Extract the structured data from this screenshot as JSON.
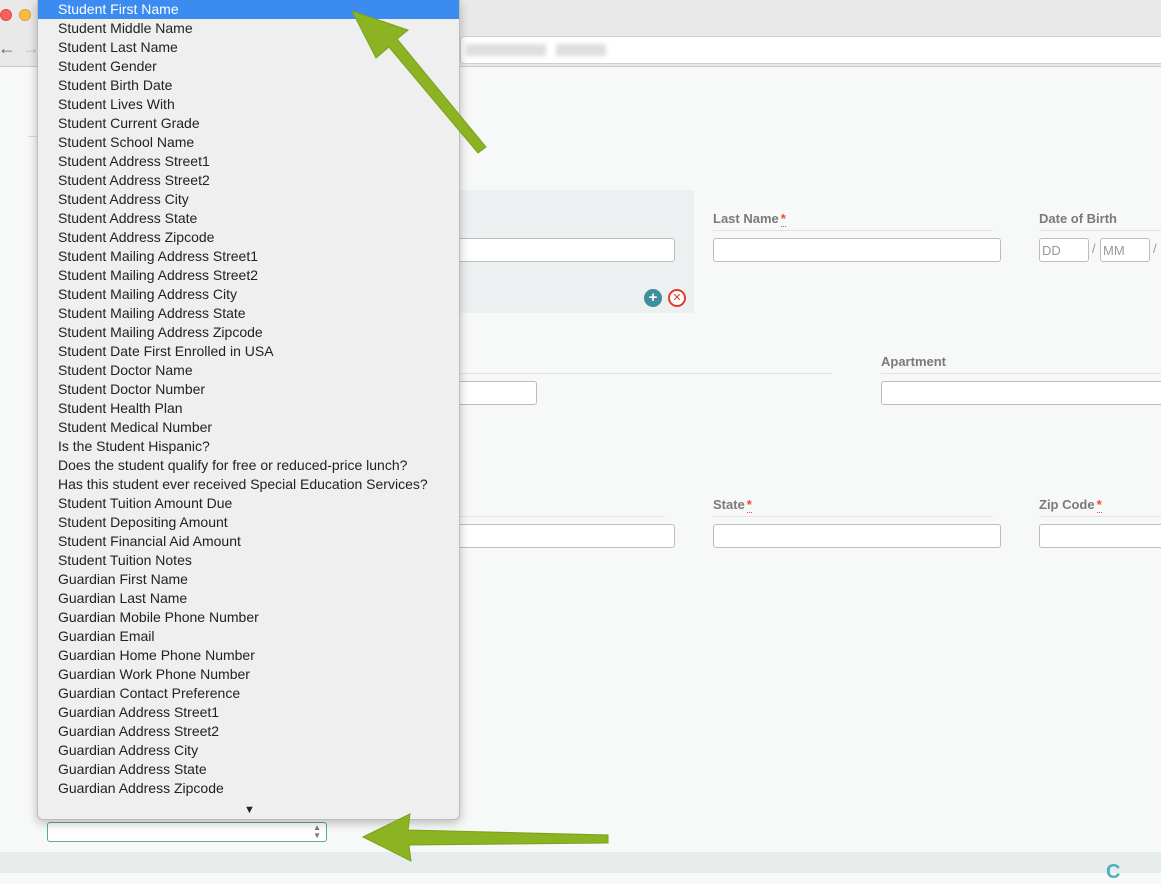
{
  "browser": {
    "nav_back_icon": "←",
    "nav_forward_icon": "→"
  },
  "form": {
    "last_name_label": "Last Name",
    "dob_label": "Date of Birth",
    "dob_dd_placeholder": "DD",
    "dob_mm_placeholder": "MM",
    "apartment_label": "Apartment",
    "state_label": "State",
    "zip_label": "Zip Code",
    "required_mark": "*",
    "slash": "/"
  },
  "dropdown": {
    "selected_index": 0,
    "options": [
      "Student First Name",
      "Student Middle Name",
      "Student Last Name",
      "Student Gender",
      "Student Birth Date",
      "Student Lives With",
      "Student Current Grade",
      "Student School Name",
      "Student Address Street1",
      "Student Address Street2",
      "Student Address City",
      "Student Address State",
      "Student Address Zipcode",
      "Student Mailing Address Street1",
      "Student Mailing Address Street2",
      "Student Mailing Address City",
      "Student Mailing Address State",
      "Student Mailing Address Zipcode",
      "Student Date First Enrolled in USA",
      "Student Doctor Name",
      "Student Doctor Number",
      "Student Health Plan",
      "Student Medical Number",
      "Is the Student Hispanic?",
      "Does the student qualify for free or reduced-price lunch?",
      "Has this student ever received Special Education Services?",
      "Student Tuition Amount Due",
      "Student Depositing Amount",
      "Student Financial Aid Amount",
      "Student Tuition Notes",
      "Guardian First Name",
      "Guardian Last Name",
      "Guardian Mobile Phone Number",
      "Guardian Email",
      "Guardian Home Phone Number",
      "Guardian Work Phone Number",
      "Guardian Contact Preference",
      "Guardian Address Street1",
      "Guardian Address Street2",
      "Guardian Address City",
      "Guardian Address State",
      "Guardian Address Zipcode"
    ],
    "scroll_indicator": "▼"
  },
  "select_spinner": "▲▼",
  "footer_mark": "C"
}
